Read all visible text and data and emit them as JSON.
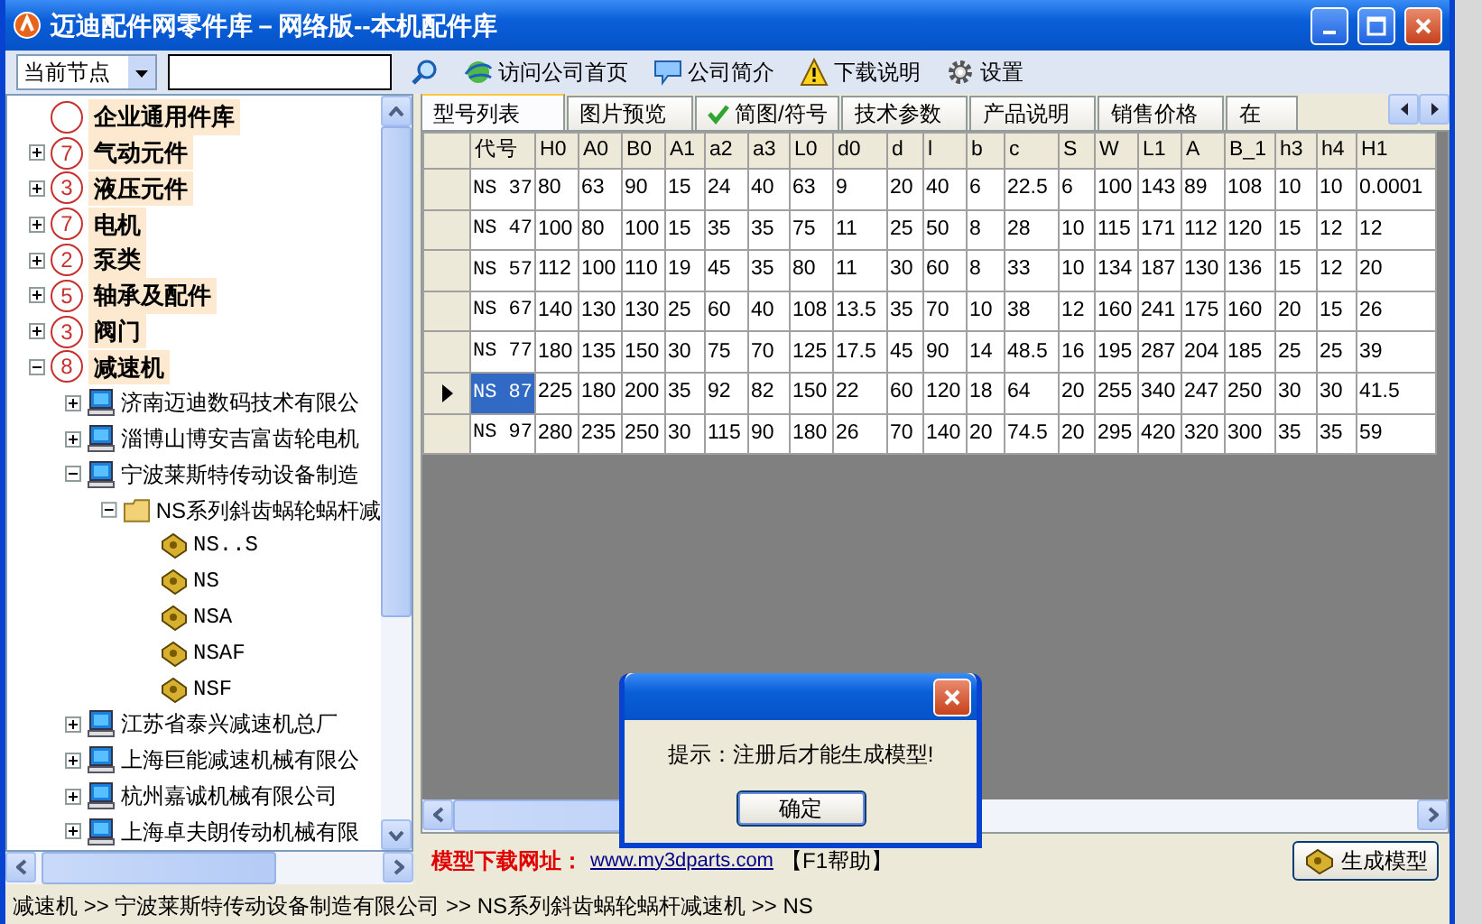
{
  "window": {
    "title": "迈迪配件网零件库－网络版--本机配件库"
  },
  "toolbar": {
    "node_select": "当前节点",
    "buttons": [
      {
        "kind": "home",
        "label": "访问公司首页"
      },
      {
        "kind": "intro",
        "label": "公司简介"
      },
      {
        "kind": "download",
        "label": "下载说明"
      },
      {
        "kind": "settings",
        "label": "设置"
      }
    ]
  },
  "tree": [
    {
      "label": "企业通用件库",
      "kind": "category",
      "expandable": false
    },
    {
      "label": "气动元件",
      "kind": "category",
      "badge": "7",
      "expandable": true,
      "expanded": false
    },
    {
      "label": "液压元件",
      "kind": "category",
      "badge": "3",
      "expandable": true,
      "expanded": false
    },
    {
      "label": "电机",
      "kind": "category",
      "badge": "7",
      "expandable": true,
      "expanded": false
    },
    {
      "label": "泵类",
      "kind": "category",
      "badge": "2",
      "expandable": true,
      "expanded": false
    },
    {
      "label": "轴承及配件",
      "kind": "category",
      "badge": "5",
      "expandable": true,
      "expanded": false
    },
    {
      "label": "阀门",
      "kind": "category",
      "badge": "3",
      "expandable": true,
      "expanded": false
    },
    {
      "label": "减速机",
      "kind": "category",
      "badge": "8",
      "expandable": true,
      "expanded": true,
      "children": [
        {
          "label": "济南迈迪数码技术有限公",
          "kind": "company",
          "expandable": true,
          "expanded": false
        },
        {
          "label": "淄博山博安吉富齿轮电机",
          "kind": "company",
          "expandable": true,
          "expanded": false
        },
        {
          "label": "宁波莱斯特传动设备制造",
          "kind": "company",
          "expandable": true,
          "expanded": true,
          "children": [
            {
              "label": "NS系列斜齿蜗轮蜗杆减",
              "kind": "folder",
              "expandable": true,
              "expanded": true,
              "children": [
                {
                  "label": "NS..S",
                  "kind": "part",
                  "expandable": false
                },
                {
                  "label": "NS",
                  "kind": "part",
                  "expandable": false
                },
                {
                  "label": "NSA",
                  "kind": "part",
                  "expandable": false
                },
                {
                  "label": "NSAF",
                  "kind": "part",
                  "expandable": false
                },
                {
                  "label": "NSF",
                  "kind": "part",
                  "expandable": false
                }
              ]
            }
          ]
        },
        {
          "label": "江苏省泰兴减速机总厂",
          "kind": "company",
          "expandable": true,
          "expanded": false
        },
        {
          "label": "上海巨能减速机械有限公",
          "kind": "company",
          "expandable": true,
          "expanded": false
        },
        {
          "label": "杭州嘉诚机械有限公司",
          "kind": "company",
          "expandable": true,
          "expanded": false
        },
        {
          "label": "上海卓夫朗传动机械有限",
          "kind": "company",
          "expandable": true,
          "expanded": false
        }
      ]
    }
  ],
  "tabs": [
    {
      "label": "型号列表",
      "selected": true,
      "checked": false
    },
    {
      "label": "图片预览",
      "selected": false,
      "checked": false
    },
    {
      "label": "简图/符号",
      "selected": false,
      "checked": true
    },
    {
      "label": "技术参数",
      "selected": false,
      "checked": false
    },
    {
      "label": "产品说明",
      "selected": false,
      "checked": false
    },
    {
      "label": "销售价格",
      "selected": false,
      "checked": false
    },
    {
      "label": "在",
      "selected": false,
      "checked": false
    }
  ],
  "grid": {
    "columns": [
      "代号",
      "H0",
      "A0",
      "B0",
      "A1",
      "a2",
      "a3",
      "L0",
      "d0",
      "d",
      "l",
      "b",
      "c",
      "S",
      "W",
      "L1",
      "A",
      "B_1",
      "h3",
      "h4",
      "H1"
    ],
    "rows": [
      {
        "selected": false,
        "cells": [
          "NS 37",
          "80",
          "63",
          "90",
          "15",
          "24",
          "40",
          "63",
          "9",
          "20",
          "40",
          "6",
          "22.5",
          "6",
          "100",
          "143",
          "89",
          "108",
          "10",
          "10",
          "0.0001"
        ]
      },
      {
        "selected": false,
        "cells": [
          "NS 47",
          "100",
          "80",
          "100",
          "15",
          "35",
          "35",
          "75",
          "11",
          "25",
          "50",
          "8",
          "28",
          "10",
          "115",
          "171",
          "112",
          "120",
          "15",
          "12",
          "12"
        ]
      },
      {
        "selected": false,
        "cells": [
          "NS 57",
          "112",
          "100",
          "110",
          "19",
          "45",
          "35",
          "80",
          "11",
          "30",
          "60",
          "8",
          "33",
          "10",
          "134",
          "187",
          "130",
          "136",
          "15",
          "12",
          "20"
        ]
      },
      {
        "selected": false,
        "cells": [
          "NS 67",
          "140",
          "130",
          "130",
          "25",
          "60",
          "40",
          "108",
          "13.5",
          "35",
          "70",
          "10",
          "38",
          "12",
          "160",
          "241",
          "175",
          "160",
          "20",
          "15",
          "26"
        ]
      },
      {
        "selected": false,
        "cells": [
          "NS 77",
          "180",
          "135",
          "150",
          "30",
          "75",
          "70",
          "125",
          "17.5",
          "45",
          "90",
          "14",
          "48.5",
          "16",
          "195",
          "287",
          "204",
          "185",
          "25",
          "25",
          "39"
        ]
      },
      {
        "selected": true,
        "cells": [
          "NS 87",
          "225",
          "180",
          "200",
          "35",
          "92",
          "82",
          "150",
          "22",
          "60",
          "120",
          "18",
          "64",
          "20",
          "255",
          "340",
          "247",
          "250",
          "30",
          "30",
          "41.5"
        ]
      },
      {
        "selected": false,
        "cells": [
          "NS 97",
          "280",
          "235",
          "250",
          "30",
          "115",
          "90",
          "180",
          "26",
          "70",
          "140",
          "20",
          "74.5",
          "20",
          "295",
          "420",
          "320",
          "300",
          "35",
          "35",
          "59"
        ]
      }
    ]
  },
  "footer": {
    "label": "模型下载网址：",
    "link": "www.my3dparts.com",
    "help": "【F1帮助】",
    "button": "生成模型"
  },
  "status_bar": "减速机 >> 宁波莱斯特传动设备制造有限公司 >> NS系列斜齿蜗轮蜗杆减速机 >> NS",
  "dialog": {
    "message": "提示：注册后才能生成模型!",
    "button": "确定"
  }
}
